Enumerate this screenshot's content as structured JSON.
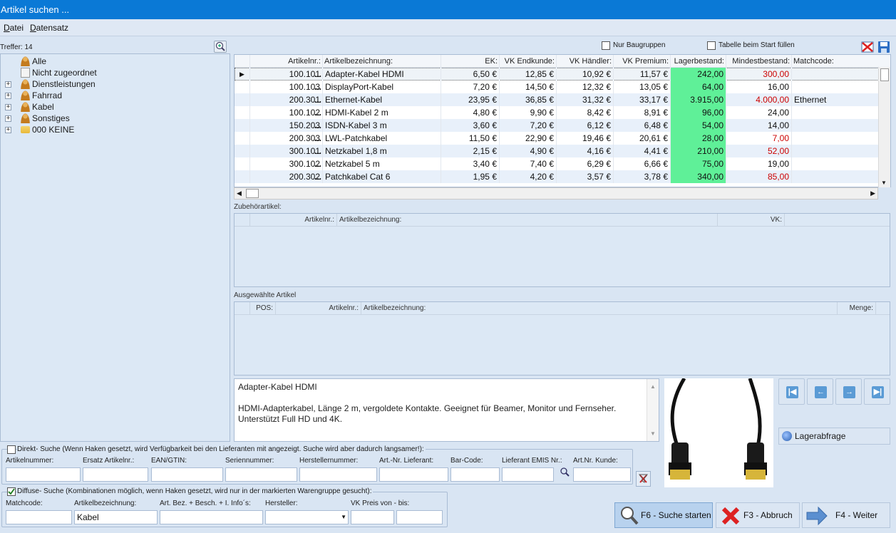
{
  "window": {
    "title": "Artikel suchen ..."
  },
  "menu": {
    "items": [
      "Datei",
      "Datensatz"
    ]
  },
  "tree": {
    "hits_label": "Treffer: 14",
    "items": [
      {
        "label": "Alle",
        "expandable": false,
        "icon": "user-group-icon"
      },
      {
        "label": "Nicht zugeordnet",
        "expandable": false,
        "icon": "document-icon"
      },
      {
        "label": "Dienstleistungen",
        "expandable": true,
        "icon": "user-group-icon"
      },
      {
        "label": "Fahrrad",
        "expandable": true,
        "icon": "user-group-icon"
      },
      {
        "label": "Kabel",
        "expandable": true,
        "icon": "user-group-icon"
      },
      {
        "label": "Sonstiges",
        "expandable": true,
        "icon": "user-group-icon"
      },
      {
        "label": "000 KEINE",
        "expandable": true,
        "icon": "folder-icon"
      }
    ]
  },
  "options": {
    "nur_baugruppen": "Nur Baugruppen",
    "tabelle_start": "Tabelle beim Start füllen"
  },
  "grid": {
    "headers": [
      "Artikelnr.:",
      "Artikelbezeichnung:",
      "EK:",
      "VK Endkunde:",
      "VK Händler:",
      "VK Premium:",
      "Lagerbestand:",
      "Mindestbestand:",
      "Matchcode:"
    ],
    "rows": [
      {
        "nr": "100.101",
        "bez": "Adapter-Kabel HDMI",
        "ek": "6,50 €",
        "vke": "12,85 €",
        "vkh": "10,92 €",
        "vkp": "11,57 €",
        "lager": "242,00",
        "min": "300,00",
        "match": "",
        "min_red": true
      },
      {
        "nr": "100.103",
        "bez": "DisplayPort-Kabel",
        "ek": "7,20 €",
        "vke": "14,50 €",
        "vkh": "12,32 €",
        "vkp": "13,05 €",
        "lager": "64,00",
        "min": "16,00",
        "match": "",
        "min_red": false
      },
      {
        "nr": "200.301",
        "bez": "Ethernet-Kabel",
        "ek": "23,95 €",
        "vke": "36,85 €",
        "vkh": "31,32 €",
        "vkp": "33,17 €",
        "lager": "3.915,00",
        "min": "4.000,00",
        "match": "Ethernet",
        "min_red": true
      },
      {
        "nr": "100.102",
        "bez": "HDMI-Kabel 2 m",
        "ek": "4,80 €",
        "vke": "9,90 €",
        "vkh": "8,42 €",
        "vkp": "8,91 €",
        "lager": "96,00",
        "min": "24,00",
        "match": "",
        "min_red": false
      },
      {
        "nr": "150.203",
        "bez": "ISDN-Kabel 3 m",
        "ek": "3,60 €",
        "vke": "7,20 €",
        "vkh": "6,12 €",
        "vkp": "6,48 €",
        "lager": "54,00",
        "min": "14,00",
        "match": "",
        "min_red": false
      },
      {
        "nr": "200.303",
        "bez": "LWL-Patchkabel",
        "ek": "11,50 €",
        "vke": "22,90 €",
        "vkh": "19,46 €",
        "vkp": "20,61 €",
        "lager": "28,00",
        "min": "7,00",
        "match": "",
        "min_red": true
      },
      {
        "nr": "300.101",
        "bez": "Netzkabel 1,8 m",
        "ek": "2,15 €",
        "vke": "4,90 €",
        "vkh": "4,16 €",
        "vkp": "4,41 €",
        "lager": "210,00",
        "min": "52,00",
        "match": "",
        "min_red": true
      },
      {
        "nr": "300.102",
        "bez": "Netzkabel 5 m",
        "ek": "3,40 €",
        "vke": "7,40 €",
        "vkh": "6,29 €",
        "vkp": "6,66 €",
        "lager": "75,00",
        "min": "19,00",
        "match": "",
        "min_red": false
      },
      {
        "nr": "200.302",
        "bez": "Patchkabel Cat 6",
        "ek": "1,95 €",
        "vke": "4,20 €",
        "vkh": "3,57 €",
        "vkp": "3,78 €",
        "lager": "340,00",
        "min": "85,00",
        "match": "",
        "min_red": true
      }
    ]
  },
  "zubehoer": {
    "title": "Zubehörartikel:",
    "headers": [
      "Artikelnr.:",
      "Artikelbezeichnung:",
      "VK:"
    ]
  },
  "ausgewaehlt": {
    "title": "Ausgewählte Artikel",
    "headers": [
      "POS:",
      "Artikelnr.:",
      "Artikelbezeichnung:",
      "Menge:"
    ]
  },
  "description": {
    "title": "Adapter-Kabel HDMI",
    "line1": "HDMI-Adapterkabel, Länge 2 m, vergoldete Kontakte. Geeignet für Beamer, Monitor und Fernseher.",
    "line2": "Unterstützt Full HD und 4K."
  },
  "lager_button": "Lagerabfrage",
  "direkt": {
    "label": "Direkt- Suche (Wenn Haken gesetzt, wird Verfügbarkeit bei den Lieferanten mit angezeigt. Suche wird aber dadurch langsamer!):",
    "checked": false,
    "fields": [
      "Artikelnummer:",
      "Ersatz Artikelnr.:",
      "EAN/GTIN:",
      "Seriennummer:",
      "Herstellernummer:",
      "Art.-Nr. Lieferant:",
      "Bar-Code:",
      "Lieferant EMIS Nr.:",
      "Art.Nr. Kunde:"
    ]
  },
  "diffuse": {
    "label": "Diffuse- Suche (Kombinationen möglich, wenn Haken gesetzt, wird nur in der markierten Warengruppe gesucht):",
    "checked": true,
    "fields": [
      "Matchcode:",
      "Artikelbezeichnung:",
      "Art. Bez. + Besch. + I. Info´s:",
      "Hersteller:",
      "VK Preis von - bis:"
    ],
    "artikelbezeichnung_value": "Kabel"
  },
  "buttons": {
    "search": "F6 - Suche starten",
    "cancel": "F3 - Abbruch",
    "next": "F4 - Weiter"
  },
  "colors": {
    "titlebar": "#0a79d6",
    "stock_ok": "#5ff098",
    "below_min": "#cc0000"
  }
}
